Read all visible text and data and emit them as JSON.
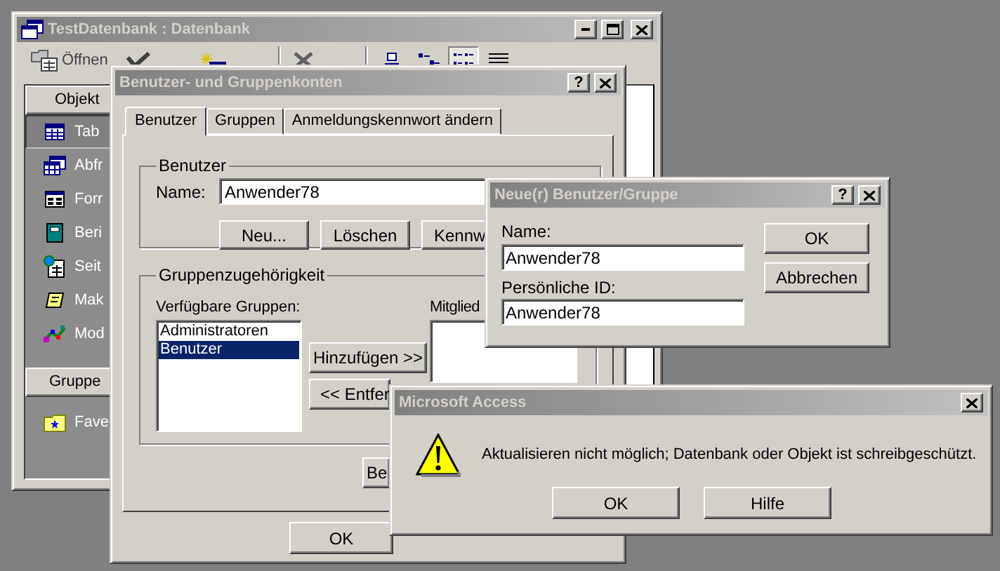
{
  "main_window": {
    "title": "TestDatenbank : Datenbank",
    "toolbar": [
      {
        "kind": "open",
        "label": "Öffnen"
      },
      {
        "kind": "design"
      },
      {
        "kind": "new"
      },
      {
        "kind": "delete"
      },
      {
        "kind": "large_icons",
        "selected": false
      },
      {
        "kind": "small_icons",
        "selected": false
      },
      {
        "kind": "list",
        "selected": true
      },
      {
        "kind": "details",
        "selected": false
      }
    ],
    "objects_header": "Objekt",
    "objects": [
      {
        "kind": "table",
        "label": "Tab",
        "selected": true
      },
      {
        "kind": "query",
        "label": "Abfr",
        "selected": false
      },
      {
        "kind": "form",
        "label": "Forr",
        "selected": false
      },
      {
        "kind": "report",
        "label": "Beri",
        "selected": false
      },
      {
        "kind": "page",
        "label": "Seit",
        "selected": false
      },
      {
        "kind": "macro",
        "label": "Mak",
        "selected": false
      },
      {
        "kind": "module",
        "label": "Mod",
        "selected": false
      }
    ],
    "groups_header": "Gruppe",
    "groups": [
      {
        "kind": "favorites",
        "label": "Fave",
        "selected": false
      }
    ]
  },
  "accounts_dialog": {
    "title": "Benutzer- und Gruppenkonten",
    "help_button": "?",
    "tabs": [
      {
        "label": "Benutzer",
        "selected": true
      },
      {
        "label": "Gruppen",
        "selected": false
      },
      {
        "label": "Anmeldungskennwort ändern",
        "selected": false
      }
    ],
    "user_group": {
      "title": "Benutzer",
      "name_label": "Name:",
      "name_value": "Anwender78",
      "buttons": [
        "Neu...",
        "Löschen",
        "Kennw"
      ]
    },
    "membership": {
      "title": "Gruppenzugehörigkeit",
      "available_label": "Verfügbare Gruppen:",
      "available_groups": [
        {
          "label": "Administratoren",
          "selected": false
        },
        {
          "label": "Benutzer",
          "selected": true
        }
      ],
      "add_button": "Hinzufügen >>",
      "remove_button": "<< Entfer",
      "member_label": "Mitglied"
    },
    "print_button": "Be",
    "ok_button": "OK"
  },
  "new_user_dialog": {
    "title": "Neue(r) Benutzer/Gruppe",
    "help_button": "?",
    "name_label": "Name:",
    "name_value": "Anwender78",
    "id_label": "Persönliche ID:",
    "id_value": "Anwender78",
    "ok_button": "OK",
    "cancel_button": "Abbrechen"
  },
  "alert_dialog": {
    "title": "Microsoft Access",
    "message": "Aktualisieren nicht möglich; Datenbank oder Objekt ist schreibgeschützt.",
    "buttons": [
      "OK",
      "Hilfe"
    ]
  }
}
